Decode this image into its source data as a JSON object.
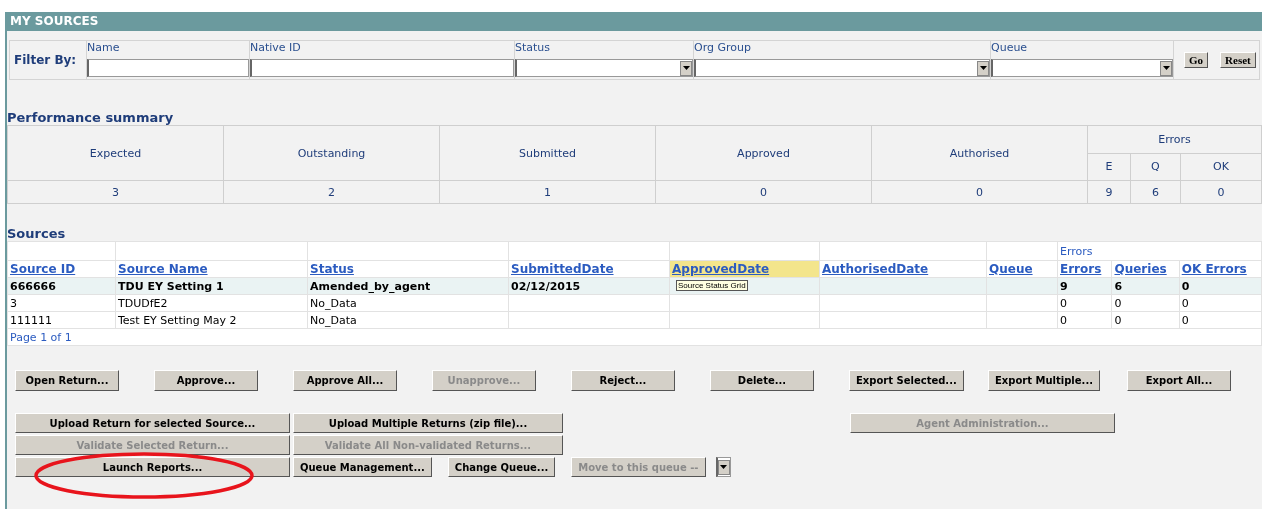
{
  "panel": {
    "title": "MY SOURCES"
  },
  "filter": {
    "label": "Filter By:",
    "fields": [
      {
        "label": "Name",
        "kind": "text"
      },
      {
        "label": "Native ID",
        "kind": "text"
      },
      {
        "label": "Status",
        "kind": "select"
      },
      {
        "label": "Org Group",
        "kind": "select"
      },
      {
        "label": "Queue",
        "kind": "select"
      }
    ],
    "buttons": [
      "Go",
      "Reset"
    ]
  },
  "performance": {
    "title": "Performance summary",
    "columns": [
      "Expected",
      "Outstanding",
      "Submitted",
      "Approved",
      "Authorised"
    ],
    "errors": {
      "label": "Errors",
      "columns": [
        "E",
        "Q",
        "OK"
      ]
    },
    "values": [
      "3",
      "2",
      "1",
      "0",
      "0",
      "9",
      "6",
      "0"
    ]
  },
  "sources": {
    "title": "Sources",
    "columns": [
      {
        "label": "Source ID",
        "hovered": false
      },
      {
        "label": "Source Name",
        "hovered": false
      },
      {
        "label": "Status",
        "hovered": false
      },
      {
        "label": "SubmittedDate",
        "hovered": false
      },
      {
        "label": "ApprovedDate",
        "hovered": true
      },
      {
        "label": "AuthorisedDate",
        "hovered": false
      },
      {
        "label": "Queue",
        "hovered": false
      }
    ],
    "errors": {
      "label": "Errors",
      "columns": [
        {
          "label": "Errors",
          "hovered": false
        },
        {
          "label": "Queries",
          "hovered": false
        },
        {
          "label": "OK Errors",
          "hovered": false
        }
      ]
    },
    "rows": [
      {
        "selected": true,
        "tooltip": "Source Status Grid",
        "cells": [
          "666666",
          "TDU EY Setting 1",
          "Amended_by_agent",
          "02/12/2015",
          null,
          null,
          null,
          "9",
          "6",
          "0"
        ]
      },
      {
        "selected": false,
        "cells": [
          "3",
          "TDUDfE2",
          "No_Data",
          null,
          null,
          null,
          null,
          "0",
          "0",
          "0"
        ]
      },
      {
        "selected": false,
        "cells": [
          "111111",
          "Test EY Setting May 2",
          "No_Data",
          null,
          null,
          null,
          null,
          "0",
          "0",
          "0"
        ]
      }
    ],
    "pager": "Page 1 of 1"
  },
  "actions": [
    {
      "label": "Open Return...",
      "disabled": false
    },
    {
      "label": "Approve...",
      "disabled": false
    },
    {
      "label": "Approve All...",
      "disabled": false
    },
    {
      "label": "Unapprove...",
      "disabled": true
    },
    {
      "label": "Reject...",
      "disabled": false
    },
    {
      "label": "Delete...",
      "disabled": false
    },
    {
      "label": "Export Selected...",
      "disabled": false
    },
    {
      "label": "Export Multiple...",
      "disabled": false
    },
    {
      "label": "Export All...",
      "disabled": false
    }
  ],
  "lower_actions": [
    [
      [
        {
          "kind": "button",
          "label": "Upload Return for selected Source...",
          "disabled": false,
          "circled": false
        }
      ],
      [
        {
          "kind": "button",
          "label": "Upload Multiple Returns (zip file)...",
          "disabled": false,
          "circled": false
        }
      ],
      [
        {
          "kind": "button",
          "label": "Agent Administration...",
          "disabled": true,
          "circled": false
        }
      ]
    ],
    [
      [
        {
          "kind": "button",
          "label": "Validate Selected Return...",
          "disabled": true,
          "circled": false
        }
      ],
      [
        {
          "kind": "button",
          "label": "Validate All Non-validated Returns...",
          "disabled": true,
          "circled": false
        }
      ]
    ],
    [
      [
        {
          "kind": "button",
          "label": "Launch Reports...",
          "disabled": false,
          "circled": true
        }
      ],
      [
        {
          "kind": "button",
          "label": "Queue Management...",
          "disabled": false,
          "circled": false
        },
        {
          "kind": "button",
          "label": "Change Queue...",
          "disabled": false,
          "circled": false
        },
        {
          "kind": "button",
          "label": "Move to this queue --",
          "disabled": true,
          "circled": false
        },
        {
          "kind": "select"
        }
      ]
    ]
  ]
}
